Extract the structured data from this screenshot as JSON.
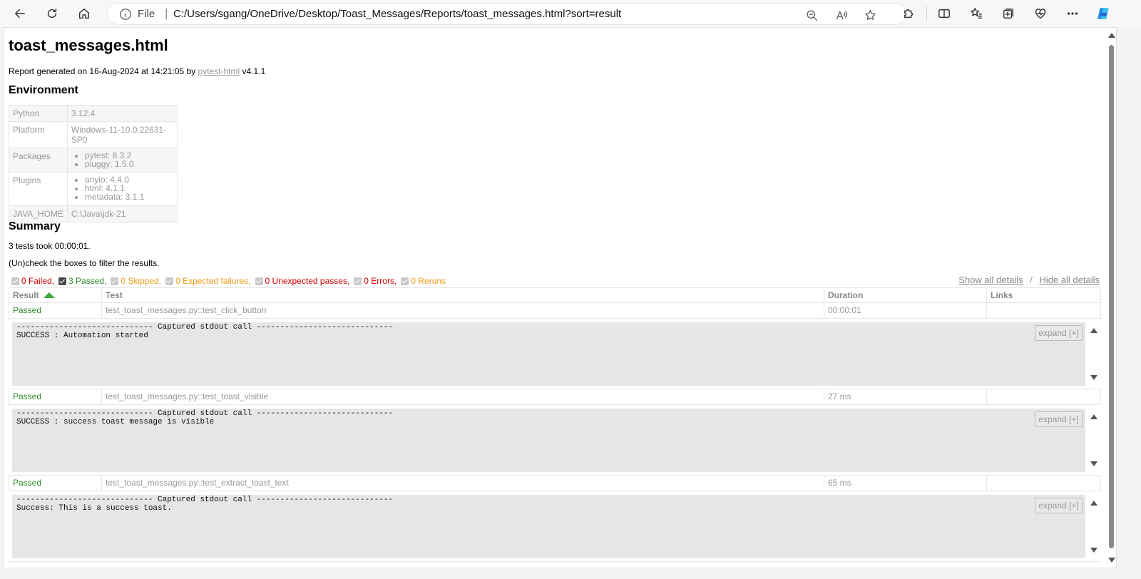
{
  "browser": {
    "file_label": "File",
    "url": "C:/Users/sgang/OneDrive/Desktop/Toast_Messages/Reports/toast_messages.html?sort=result"
  },
  "report": {
    "title": "toast_messages.html",
    "generated_prefix": "Report generated on 16-Aug-2024 at 14:21:05 by ",
    "generator_link": "pytest-html",
    "generator_version": " v4.1.1"
  },
  "environment": {
    "heading": "Environment",
    "python_key": "Python",
    "python_val": "3.12.4",
    "platform_key": "Platform",
    "platform_val": "Windows-11-10.0.22631-SP0",
    "packages_key": "Packages",
    "packages": [
      "pytest: 8.3.2",
      "pluggy: 1.5.0"
    ],
    "plugins_key": "Plugins",
    "plugins": [
      "anyio: 4.4.0",
      "html: 4.1.1",
      "metadata: 3.1.1"
    ],
    "java_key": "JAVA_HOME",
    "java_val": "C:\\Java\\jdk-21"
  },
  "summary": {
    "heading": "Summary",
    "took": "3 tests took 00:00:01.",
    "hint": "(Un)check the boxes to filter the results.",
    "filters": {
      "failed": "0 Failed,",
      "passed": "3 Passed,",
      "skipped": "0 Skipped,",
      "xfail": "0 Expected failures,",
      "xpass": "0 Unexpected passes,",
      "errors": "0 Errors,",
      "reruns": "0 Reruns"
    },
    "show_all": "Show all details",
    "sep": "/",
    "hide_all": "Hide all details"
  },
  "table": {
    "headers": {
      "result": "Result",
      "test": "Test",
      "duration": "Duration",
      "links": "Links"
    },
    "rows": [
      {
        "result": "Passed",
        "test": "test_toast_messages.py::test_click_button",
        "duration": "00:00:01",
        "log": "----------------------------- Captured stdout call -----------------------------\nSUCCESS : Automation started",
        "expand": "expand [+]"
      },
      {
        "result": "Passed",
        "test": "test_toast_messages.py::test_toast_visible",
        "duration": "27 ms",
        "log": "----------------------------- Captured stdout call -----------------------------\nSUCCESS : success toast message is visible",
        "expand": "expand [+]"
      },
      {
        "result": "Passed",
        "test": "test_toast_messages.py::test_extract_toast_text",
        "duration": "65 ms",
        "log": "----------------------------- Captured stdout call -----------------------------\nSuccess: This is a success toast.",
        "expand": "expand [+]"
      }
    ]
  }
}
